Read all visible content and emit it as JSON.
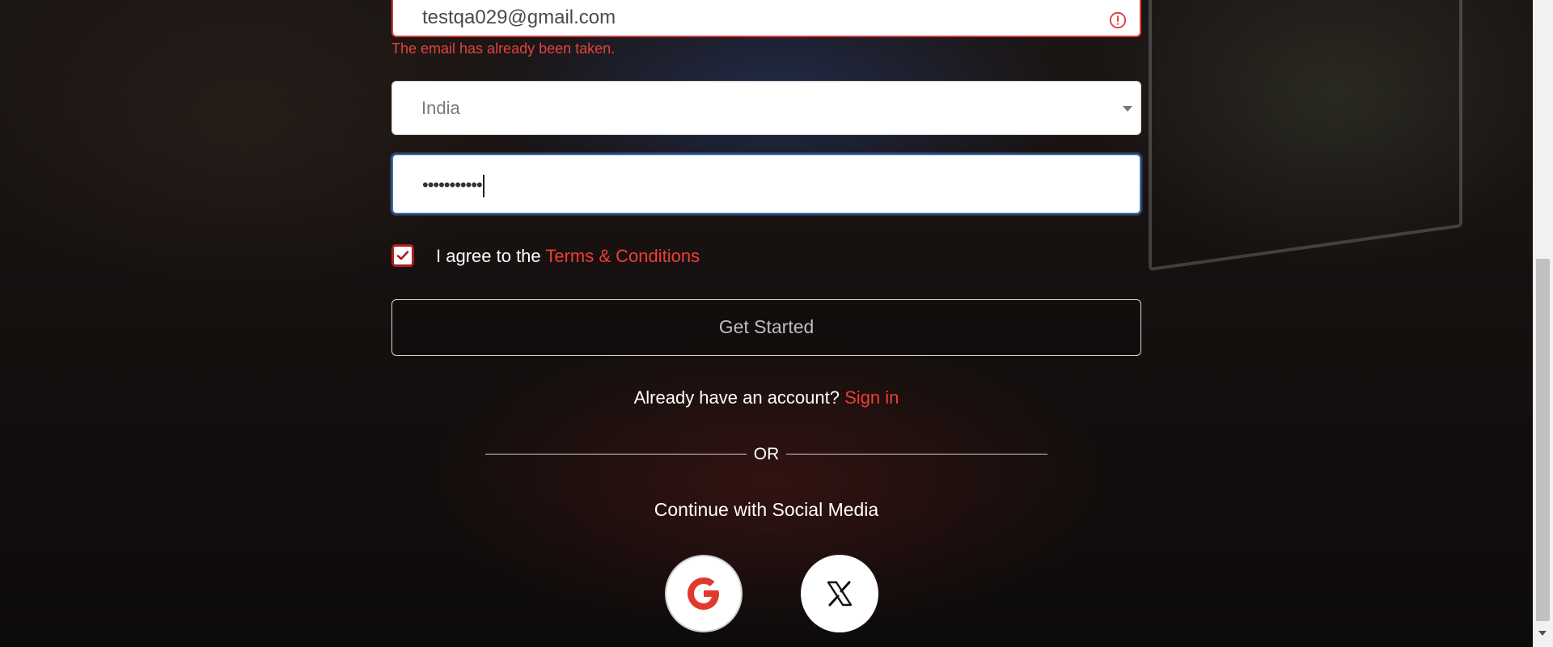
{
  "form": {
    "email_value": "testqa029@gmail.com",
    "email_error": "The email has already been taken.",
    "country_value": "India",
    "password_value": "•••••••••••",
    "agree_prefix": "I agree to the ",
    "terms_link": "Terms & Conditions",
    "agree_checked": true,
    "submit_label": "Get Started",
    "signin_prompt": "Already have an account? ",
    "signin_link": "Sign in",
    "or_text": "OR",
    "social_heading": "Continue with Social Media"
  },
  "icons": {
    "email_error": "error-circle-icon",
    "country_caret": "caret-down-icon",
    "checkbox_mark": "check-icon",
    "google": "google-icon",
    "x": "x-icon"
  },
  "colors": {
    "accent_red": "#ef3d36",
    "error_red": "#e2433f",
    "focus_blue": "#3b6fb3",
    "checkbox_border": "#b11d1d"
  }
}
